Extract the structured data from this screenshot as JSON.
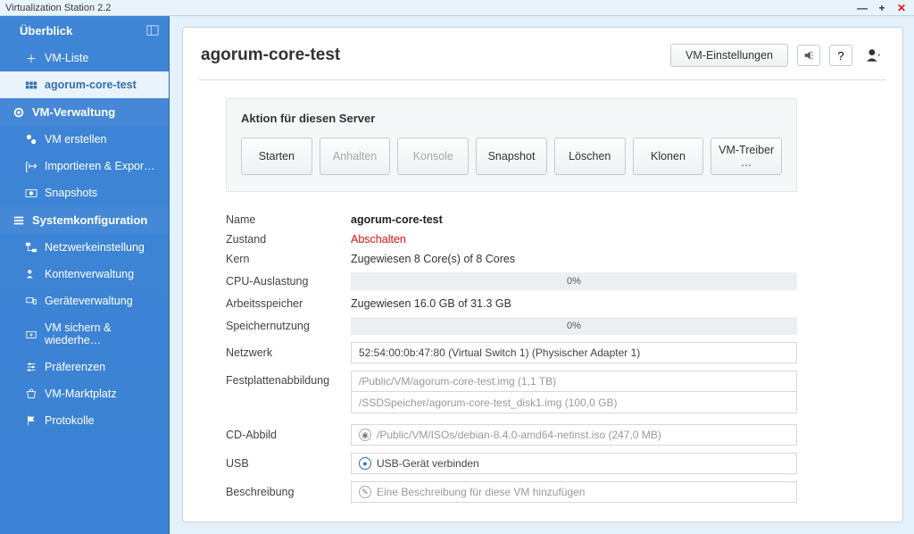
{
  "window": {
    "title": "Virtualization Station 2.2"
  },
  "sidebar": {
    "overview": "Überblick",
    "vm_list": "VM-Liste",
    "vm_selected": "agorum-core-test",
    "vm_mgmt": "VM-Verwaltung",
    "vm_create": "VM erstellen",
    "vm_import": "Importieren & Expor…",
    "snapshots": "Snapshots",
    "sysconf": "Systemkonfiguration",
    "network": "Netzwerkeinstellung",
    "accounts": "Kontenverwaltung",
    "devices": "Geräteverwaltung",
    "backup": "VM sichern & wiederhe…",
    "prefs": "Präferenzen",
    "market": "VM-Marktplatz",
    "logs": "Protokolle"
  },
  "page": {
    "title": "agorum-core-test",
    "settings_btn": "VM-Einstellungen"
  },
  "actions": {
    "title": "Aktion für diesen Server",
    "start": "Starten",
    "pause": "Anhalten",
    "console": "Konsole",
    "snapshot": "Snapshot",
    "delete": "Löschen",
    "clone": "Klonen",
    "drivers": "VM-Treiber …"
  },
  "details": {
    "labels": {
      "name": "Name",
      "state": "Zustand",
      "core": "Kern",
      "cpu": "CPU-Auslastung",
      "mem_alloc": "Arbeitsspeicher",
      "mem_use": "Speichernutzung",
      "network": "Netzwerk",
      "disk": "Festplattenabbildung",
      "cd": "CD-Abbild",
      "usb": "USB",
      "desc": "Beschreibung"
    },
    "name": "agorum-core-test",
    "state": "Abschalten",
    "core": "Zugewiesen 8 Core(s) of 8 Cores",
    "cpu_pct": "0%",
    "mem_alloc": "Zugewiesen 16.0 GB of 31.3 GB",
    "mem_pct": "0%",
    "network": "52:54:00:0b:47:80 (Virtual Switch 1) (Physischer Adapter 1)",
    "disk1": "/Public/VM/agorum-core-test.img (1,1 TB)",
    "disk2": "/SSDSpeicher/agorum-core-test_disk1.img (100,0 GB)",
    "cd": "/Public/VM/ISOs/debian-8.4.0-amd64-netinst.iso (247,0 MB)",
    "usb": "USB-Gerät verbinden",
    "desc_placeholder": "Eine Beschreibung für diese VM hinzufügen"
  }
}
